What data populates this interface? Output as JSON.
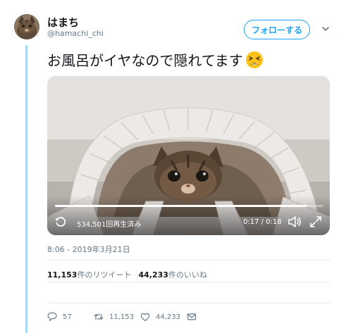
{
  "user": {
    "display_name": "はまち",
    "handle": "@hamachi_chi"
  },
  "follow_label": "フォローする",
  "tweet": {
    "text": "お風呂がイヤなので隠れてます"
  },
  "video": {
    "views_label": "534,501回再生済み",
    "time_label": "0:17 / 0:18",
    "progress": 0.94
  },
  "timestamp": "8:06 - 2019年3月21日",
  "stats": {
    "retweets_count": "11,153",
    "retweets_label": "件のリツイート",
    "likes_count": "44,233",
    "likes_label": "件のいいね"
  },
  "actions": {
    "replies": "57",
    "retweets": "11,153",
    "likes": "44,233"
  },
  "icons": {
    "follow_menu": "chevron-down-icon",
    "replay": "replay-icon",
    "volume": "volume-icon",
    "fullscreen": "fullscreen-icon",
    "reply": "reply-icon",
    "retweet": "retweet-icon",
    "like": "heart-icon",
    "dm": "envelope-icon",
    "emoji": "tired-face-emoji"
  },
  "colors": {
    "accent": "#1da1f2",
    "thread_line": "#a5d8f0",
    "secondary_text": "#657786"
  }
}
